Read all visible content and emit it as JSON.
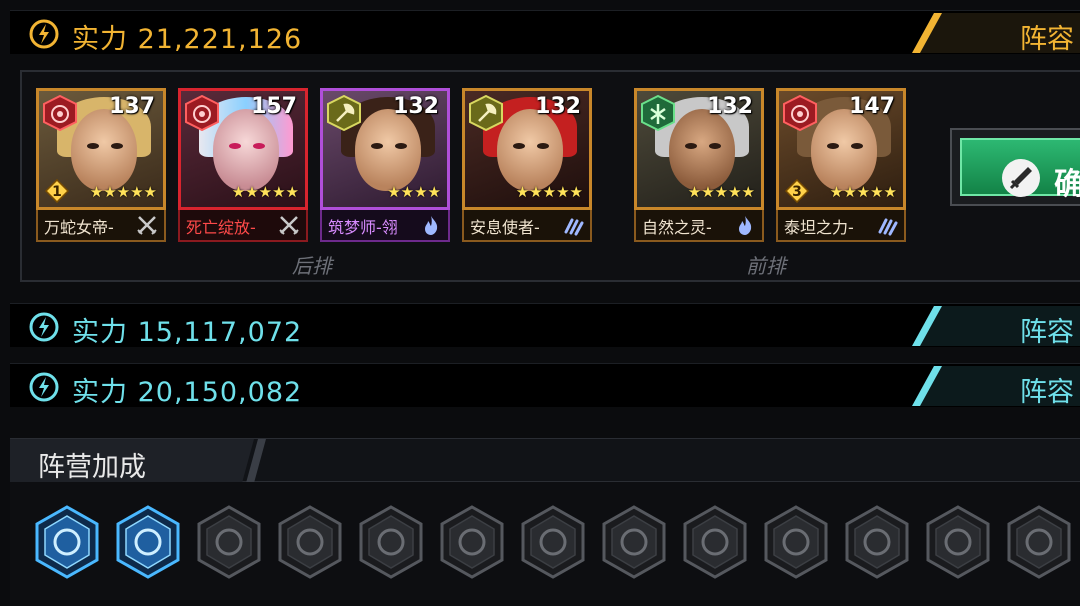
{
  "teams": [
    {
      "power_label": "实力 21,221,126",
      "tab_label": "阵容",
      "accent": "#f2b433"
    },
    {
      "power_label": "实力 15,117,072",
      "tab_label": "阵容",
      "accent": "#6fe0ea"
    },
    {
      "power_label": "实力 20,150,082",
      "tab_label": "阵容",
      "accent": "#6fe0ea"
    }
  ],
  "lineup": {
    "back_row_label": "后排",
    "front_row_label": "前排",
    "heroes": [
      {
        "name": "万蛇女帝-",
        "level": "137",
        "stars": "★★★★★",
        "badge": "1",
        "faction": "fire-target-icon",
        "class": "crossed-swords-icon",
        "frame": "orange"
      },
      {
        "name": "死亡绽放-",
        "level": "157",
        "stars": "★★★★★",
        "badge": "",
        "faction": "fire-target-icon",
        "class": "crossed-swords-icon",
        "frame": "red"
      },
      {
        "name": "筑梦师-翎",
        "level": "132",
        "stars": "★★★★",
        "badge": "",
        "faction": "axe-icon",
        "class": "flame-icon",
        "frame": "purple"
      },
      {
        "name": "安息使者-",
        "level": "132",
        "stars": "★★★★★",
        "badge": "",
        "faction": "axe-icon",
        "class": "claw-icon",
        "frame": "orange"
      },
      {
        "name": "自然之灵-",
        "level": "132",
        "stars": "★★★★★",
        "badge": "",
        "faction": "leaf-icon",
        "class": "flame-icon",
        "frame": "orange"
      },
      {
        "name": "泰坦之力-",
        "level": "147",
        "stars": "★★★★★",
        "badge": "3",
        "faction": "fire-target-icon",
        "class": "claw-icon",
        "frame": "orange"
      }
    ],
    "confirm_label": "确"
  },
  "bonus": {
    "title": "阵营加成",
    "icons": [
      {
        "name": "wolf-icon",
        "active": true
      },
      {
        "name": "fist-icon",
        "active": true
      },
      {
        "name": "cage-icon",
        "active": false
      },
      {
        "name": "beast-icon",
        "active": false
      },
      {
        "name": "crystal-icon",
        "active": false
      },
      {
        "name": "hedgehog-icon",
        "active": false
      },
      {
        "name": "eye-skull-icon",
        "active": false
      },
      {
        "name": "claw-marks-icon",
        "active": false
      },
      {
        "name": "robot-icon",
        "active": false
      },
      {
        "name": "bird-icon",
        "active": false
      },
      {
        "name": "spiral-icon",
        "active": false
      },
      {
        "name": "tank-icon",
        "active": false
      },
      {
        "name": "lion-icon",
        "active": false
      }
    ]
  }
}
